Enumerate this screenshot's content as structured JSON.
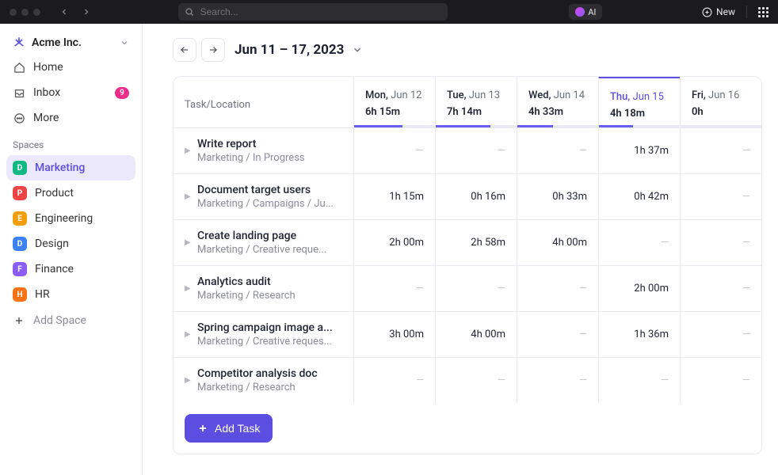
{
  "topbar": {
    "search_placeholder": "Search...",
    "ai_label": "AI",
    "new_label": "New"
  },
  "org": {
    "name": "Acme Inc."
  },
  "nav": {
    "home": "Home",
    "inbox": "Inbox",
    "inbox_count": "9",
    "more": "More"
  },
  "sidebar": {
    "spaces_header": "Spaces",
    "add_space": "Add Space",
    "spaces": [
      {
        "letter": "D",
        "color": "#10b981",
        "label": "Marketing",
        "active": true
      },
      {
        "letter": "P",
        "color": "#ef4444",
        "label": "Product"
      },
      {
        "letter": "E",
        "color": "#f59e0b",
        "label": "Engineering"
      },
      {
        "letter": "D",
        "color": "#3b82f6",
        "label": "Design"
      },
      {
        "letter": "F",
        "color": "#8b5cf6",
        "label": "Finance"
      },
      {
        "letter": "H",
        "color": "#f97316",
        "label": "HR"
      }
    ]
  },
  "dateRange": "Jun 11 – 17, 2023",
  "columns": {
    "task_header": "Task/Location",
    "days": [
      {
        "dow": "Mon,",
        "date": "Jun 12",
        "total": "6h 15m",
        "fill": 60,
        "today": false
      },
      {
        "dow": "Tue,",
        "date": "Jun 13",
        "total": "7h 14m",
        "fill": 68,
        "today": false
      },
      {
        "dow": "Wed,",
        "date": "Jun 14",
        "total": "4h 33m",
        "fill": 44,
        "today": false
      },
      {
        "dow": "Thu,",
        "date": "Jun 15",
        "total": "4h 18m",
        "fill": 42,
        "today": true
      },
      {
        "dow": "Fri,",
        "date": "Jun 16",
        "total": "0h",
        "fill": 0,
        "today": false
      }
    ]
  },
  "tasks": [
    {
      "title": "Write report",
      "path": "Marketing / In Progress",
      "times": [
        "",
        "",
        "",
        "1h  37m",
        ""
      ]
    },
    {
      "title": "Document target users",
      "path": "Marketing / Campaigns / Ju...",
      "times": [
        "1h 15m",
        "0h 16m",
        "0h 33m",
        "0h 42m",
        ""
      ]
    },
    {
      "title": "Create landing page",
      "path": "Marketing / Creative reque...",
      "times": [
        "2h 00m",
        "2h 58m",
        "4h 00m",
        "",
        ""
      ]
    },
    {
      "title": "Analytics audit",
      "path": "Marketing / Research",
      "times": [
        "",
        "",
        "",
        "2h 00m",
        ""
      ]
    },
    {
      "title": "Spring campaign image a...",
      "path": "Marketing / Creative reques...",
      "times": [
        "3h 00m",
        "4h 00m",
        "",
        "1h 36m",
        ""
      ]
    },
    {
      "title": "Competitor analysis doc",
      "path": "Marketing / Research",
      "times": [
        "",
        "",
        "",
        "",
        ""
      ]
    }
  ],
  "addTask": "Add Task",
  "dash": "—"
}
